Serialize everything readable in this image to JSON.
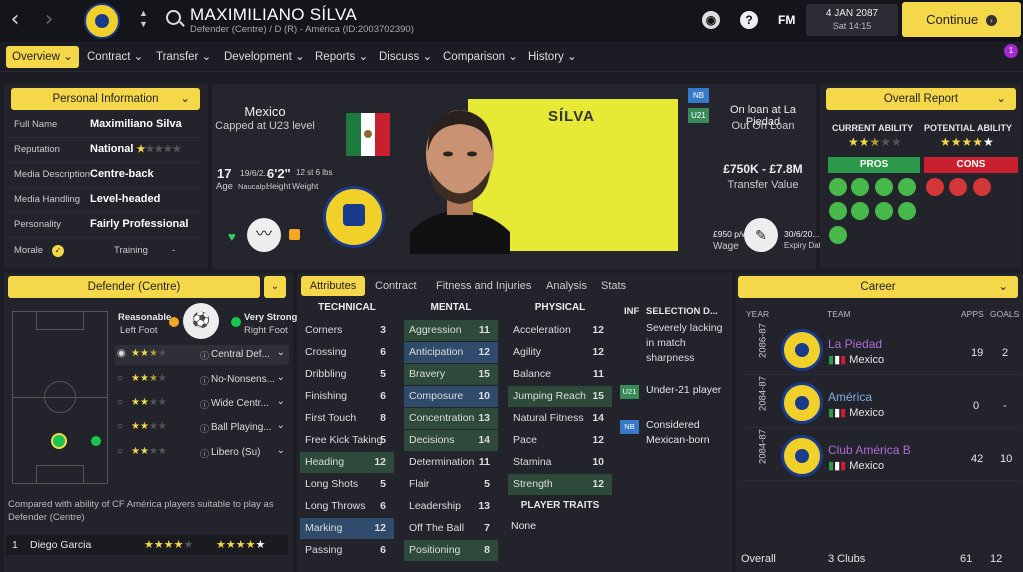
{
  "header": {
    "player_name": "MAXIMILIANO SÍLVA",
    "subtitle": "Defender (Centre) / D (R) - América (ID:2003702390)",
    "date": "4 JAN 2087",
    "time": "Sat 14:15",
    "continue_label": "Continue",
    "fm_label": "FM",
    "notif_count": "1"
  },
  "tabs": [
    "Overview",
    "Contract",
    "Transfer",
    "Development",
    "Reports",
    "Discuss",
    "Comparison",
    "History"
  ],
  "personal": {
    "header": "Personal Information",
    "rows": [
      {
        "label": "Full Name",
        "value": "Maximiliano Silva"
      },
      {
        "label": "Reputation",
        "value": "National"
      },
      {
        "label": "Media Description",
        "value": "Centre-back"
      },
      {
        "label": "Media Handling",
        "value": "Level-headed"
      },
      {
        "label": "Personality",
        "value": "Fairly Professional"
      }
    ],
    "morale_label": "Morale",
    "training_label": "Training",
    "training_value": "-"
  },
  "hero": {
    "nation": "Mexico",
    "caps": "Capped at U23 level",
    "age": "17",
    "age_label": "Age",
    "dob": "19/6/2...",
    "birthplace": "Naucalp...",
    "height": "6'2\"",
    "height_label": "Height",
    "weight": "12 st 6 lbs",
    "weight_label": "Weight",
    "surname": "SÍLVA",
    "nb_badge": "NB",
    "u21_badge": "U21",
    "loan_title": "On loan at La Piedad",
    "loan_sub": "Out On Loan",
    "value": "£750K - £7.8M",
    "value_label": "Transfer Value",
    "wage": "£950 p/w",
    "wage_label": "Wage",
    "expiry": "30/6/20...",
    "expiry_label": "Expiry Date"
  },
  "overall": {
    "header": "Overall Report",
    "ca_label": "CURRENT ABILITY",
    "pa_label": "POTENTIAL ABILITY",
    "ca_stars": 2.5,
    "pa_stars": 4.5,
    "pros_label": "PROS",
    "cons_label": "CONS"
  },
  "position": {
    "header": "Defender (Centre)",
    "left_foot_rating": "Reasonable",
    "left_foot_label": "Left Foot",
    "right_foot_rating": "Very Strong",
    "right_foot_label": "Right Foot",
    "roles": [
      {
        "name": "Central Def...",
        "stars": 2.5
      },
      {
        "name": "No-Nonsens...",
        "stars": 2.5
      },
      {
        "name": "Wide Centr...",
        "stars": 2
      },
      {
        "name": "Ball Playing...",
        "stars": 2
      },
      {
        "name": "Libero (Su)",
        "stars": 2
      }
    ],
    "compare_text": "Compared with ability of CF América players suitable to play as Defender (Centre)",
    "compare_rows": [
      {
        "rank": "1",
        "name": "Diego Garcia"
      }
    ]
  },
  "attributes": {
    "tabs": [
      "Attributes",
      "Contract",
      "Fitness and Injuries",
      "Analysis",
      "Stats"
    ],
    "technical_label": "TECHNICAL",
    "mental_label": "MENTAL",
    "physical_label": "PHYSICAL",
    "technical": [
      {
        "n": "Corners",
        "v": "3"
      },
      {
        "n": "Crossing",
        "v": "6"
      },
      {
        "n": "Dribbling",
        "v": "5"
      },
      {
        "n": "Finishing",
        "v": "6"
      },
      {
        "n": "First Touch",
        "v": "8"
      },
      {
        "n": "Free Kick Taking",
        "v": "5"
      },
      {
        "n": "Heading",
        "v": "12"
      },
      {
        "n": "Long Shots",
        "v": "5"
      },
      {
        "n": "Long Throws",
        "v": "6"
      },
      {
        "n": "Marking",
        "v": "12"
      },
      {
        "n": "Passing",
        "v": "6"
      }
    ],
    "mental": [
      {
        "n": "Aggression",
        "v": "11"
      },
      {
        "n": "Anticipation",
        "v": "12"
      },
      {
        "n": "Bravery",
        "v": "15"
      },
      {
        "n": "Composure",
        "v": "10"
      },
      {
        "n": "Concentration",
        "v": "13"
      },
      {
        "n": "Decisions",
        "v": "14"
      },
      {
        "n": "Determination",
        "v": "11"
      },
      {
        "n": "Flair",
        "v": "5"
      },
      {
        "n": "Leadership",
        "v": "13"
      },
      {
        "n": "Off The Ball",
        "v": "7"
      },
      {
        "n": "Positioning",
        "v": "8"
      }
    ],
    "physical": [
      {
        "n": "Acceleration",
        "v": "12"
      },
      {
        "n": "Agility",
        "v": "12"
      },
      {
        "n": "Balance",
        "v": "11"
      },
      {
        "n": "Jumping Reach",
        "v": "15"
      },
      {
        "n": "Natural Fitness",
        "v": "14"
      },
      {
        "n": "Pace",
        "v": "12"
      },
      {
        "n": "Stamina",
        "v": "10"
      },
      {
        "n": "Strength",
        "v": "12"
      }
    ],
    "player_traits_label": "PLAYER TRAITS",
    "player_traits_value": "None",
    "inf_label": "INF",
    "selection_label": "SELECTION D...",
    "selection_items": [
      {
        "badge": "",
        "text": "Severely lacking in match sharpness"
      },
      {
        "badge": "U21",
        "text": "Under-21 player"
      },
      {
        "badge": "NB",
        "text": "Considered Mexican-born"
      }
    ]
  },
  "career": {
    "header": "Career",
    "col_year": "YEAR",
    "col_team": "TEAM",
    "col_apps": "APPS",
    "col_goals": "GOALS",
    "rows": [
      {
        "year": "2086-87",
        "team": "La Piedad",
        "nation": "Mexico",
        "apps": "19",
        "goals": "2",
        "color": "#b06bd8"
      },
      {
        "year": "2084-87",
        "team": "América",
        "nation": "Mexico",
        "apps": "0",
        "goals": "-",
        "color": "#7fb3e0"
      },
      {
        "year": "2084-87",
        "team": "Club América B",
        "nation": "Mexico",
        "apps": "42",
        "goals": "10",
        "color": "#b06bd8"
      }
    ],
    "overall_label": "Overall",
    "overall_clubs": "3 Clubs",
    "overall_apps": "61",
    "overall_goals": "12"
  }
}
